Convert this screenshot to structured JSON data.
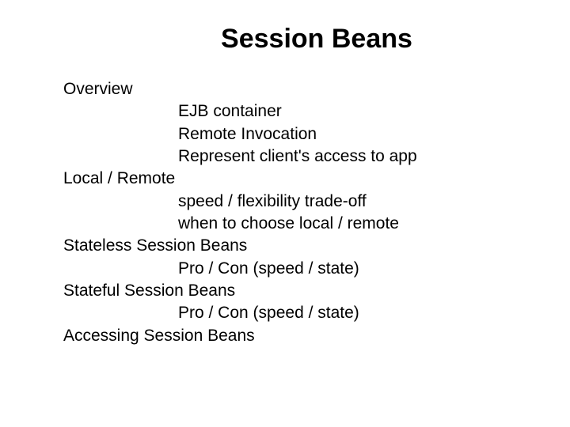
{
  "title": "Session Beans",
  "outline": [
    {
      "level": 0,
      "text": "Overview"
    },
    {
      "level": 1,
      "text": "EJB container"
    },
    {
      "level": 1,
      "text": "Remote Invocation"
    },
    {
      "level": 1,
      "text": "Represent client's access to app"
    },
    {
      "level": 0,
      "text": "Local / Remote"
    },
    {
      "level": 1,
      "text": "speed / flexibility trade-off"
    },
    {
      "level": 1,
      "text": "when to choose local / remote"
    },
    {
      "level": 0,
      "text": "Stateless Session Beans"
    },
    {
      "level": 1,
      "text": "Pro / Con (speed / state)"
    },
    {
      "level": 0,
      "text": "Stateful Session Beans"
    },
    {
      "level": 1,
      "text": "Pro / Con (speed / state)"
    },
    {
      "level": 0,
      "text": "Accessing Session Beans"
    }
  ]
}
